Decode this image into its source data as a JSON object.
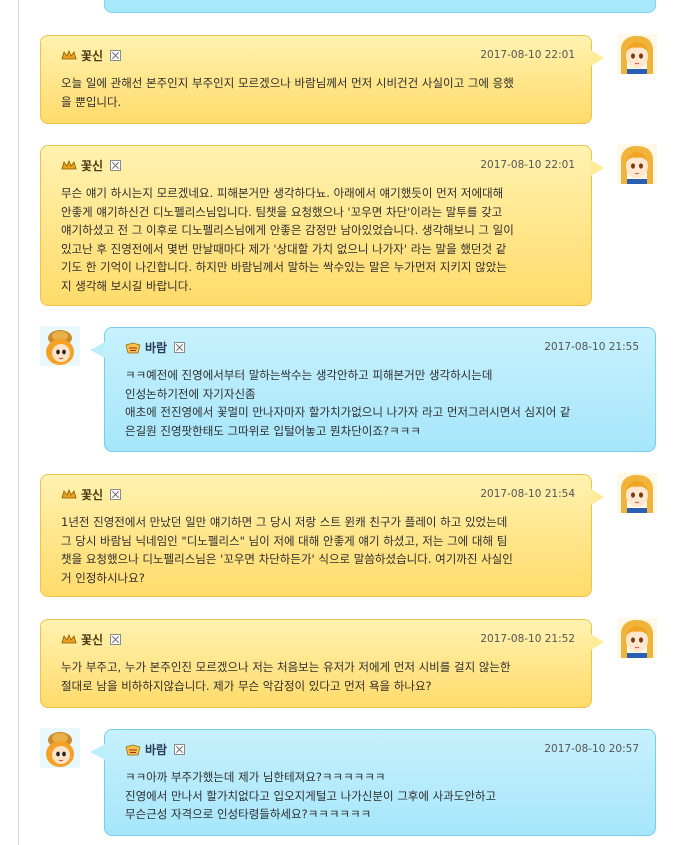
{
  "messages": [
    {
      "side": "right",
      "name": "꽃신",
      "time": "2017-08-10 22:01",
      "text": "오늘 일에 관해선 본주인지 부주인지 모르겠으나 바람님께서 먼저 시비건건 사실이고 그에 응했\n을 뿐입니다."
    },
    {
      "side": "right",
      "name": "꽃신",
      "time": "2017-08-10 22:01",
      "text": "무슨 얘기 하시는지 모르겠네요. 피해본거만 생각하다뇨. 아래에서 얘기했듯이 먼저 저에대해\n안좋게 얘기하신건 디노펠리스님입니다. 팀챗을 요청했으나 '꼬우면 차단'이라는 말투를 갖고\n얘기하셨고 전 그 이후로 디노펠리스님에게 안좋은 감정만 남아있었습니다. 생각해보니 그 일이\n있고난 후 진영전에서 몇번 만날때마다 제가 '상대할 가치 없으니 나가자' 라는 말을 했던것 같\n기도 한 기억이 나긴합니다. 하지만 바람님께서 말하는 싹수있는 말은 누가먼저 지키지 않았는\n지 생각해 보시길 바랍니다."
    },
    {
      "side": "left",
      "name": "바람",
      "time": "2017-08-10 21:55",
      "text": "ㅋㅋ예전에 진영에서부터 말하는싹수는 생각안하고 피해본거만 생각하시는데\n인성논하기전에 자기자신좀\n애초에 전진영에서 꽃멀미 만나자마자 할가치가없으니 나가자 라고 먼저그러시면서 심지어 같\n은길원 진영팟한태도 그따위로 입털어놓고 뭔차단이죠?ㅋㅋㅋ"
    },
    {
      "side": "right",
      "name": "꽃신",
      "time": "2017-08-10 21:54",
      "text": "1년전 진영전에서 만났던 일만 얘기하면 그 당시 저랑 스트 윈캐 친구가 플레이 하고 있었는데\n그 당시 바람님 닉네임인 \"디노펠리스\" 님이 저에 대해 안좋게 얘기 하셨고, 저는 그에 대해 팀\n챗을 요청했으나 디노펠리스님은 '꼬우면 차단하든가' 식으로 말씀하셨습니다. 여기까진 사실인\n거 인정하시나요?"
    },
    {
      "side": "right",
      "name": "꽃신",
      "time": "2017-08-10 21:52",
      "text": "누가 부주고, 누가 본주인진 모르겠으나 저는 처음보는 유저가 저에게 먼저 시비를 걸지 않는한\n절대로 남을 비하하지않습니다. 제가 무슨 악감정이 있다고 먼저 욕을 하나요?"
    },
    {
      "side": "left",
      "name": "바람",
      "time": "2017-08-10 20:57",
      "text": "ㅋㅋ아까 부주가했는데 제가 님한테져요?ㅋㅋㅋㅋㅋㅋ\n진영에서 만나서 할가치없다고 입오지게털고 나가신분이 그후에 사과도안하고\n무슨근성 자격으로 인성타령들하세요?ㅋㅋㅋㅋㅋㅋ"
    }
  ]
}
